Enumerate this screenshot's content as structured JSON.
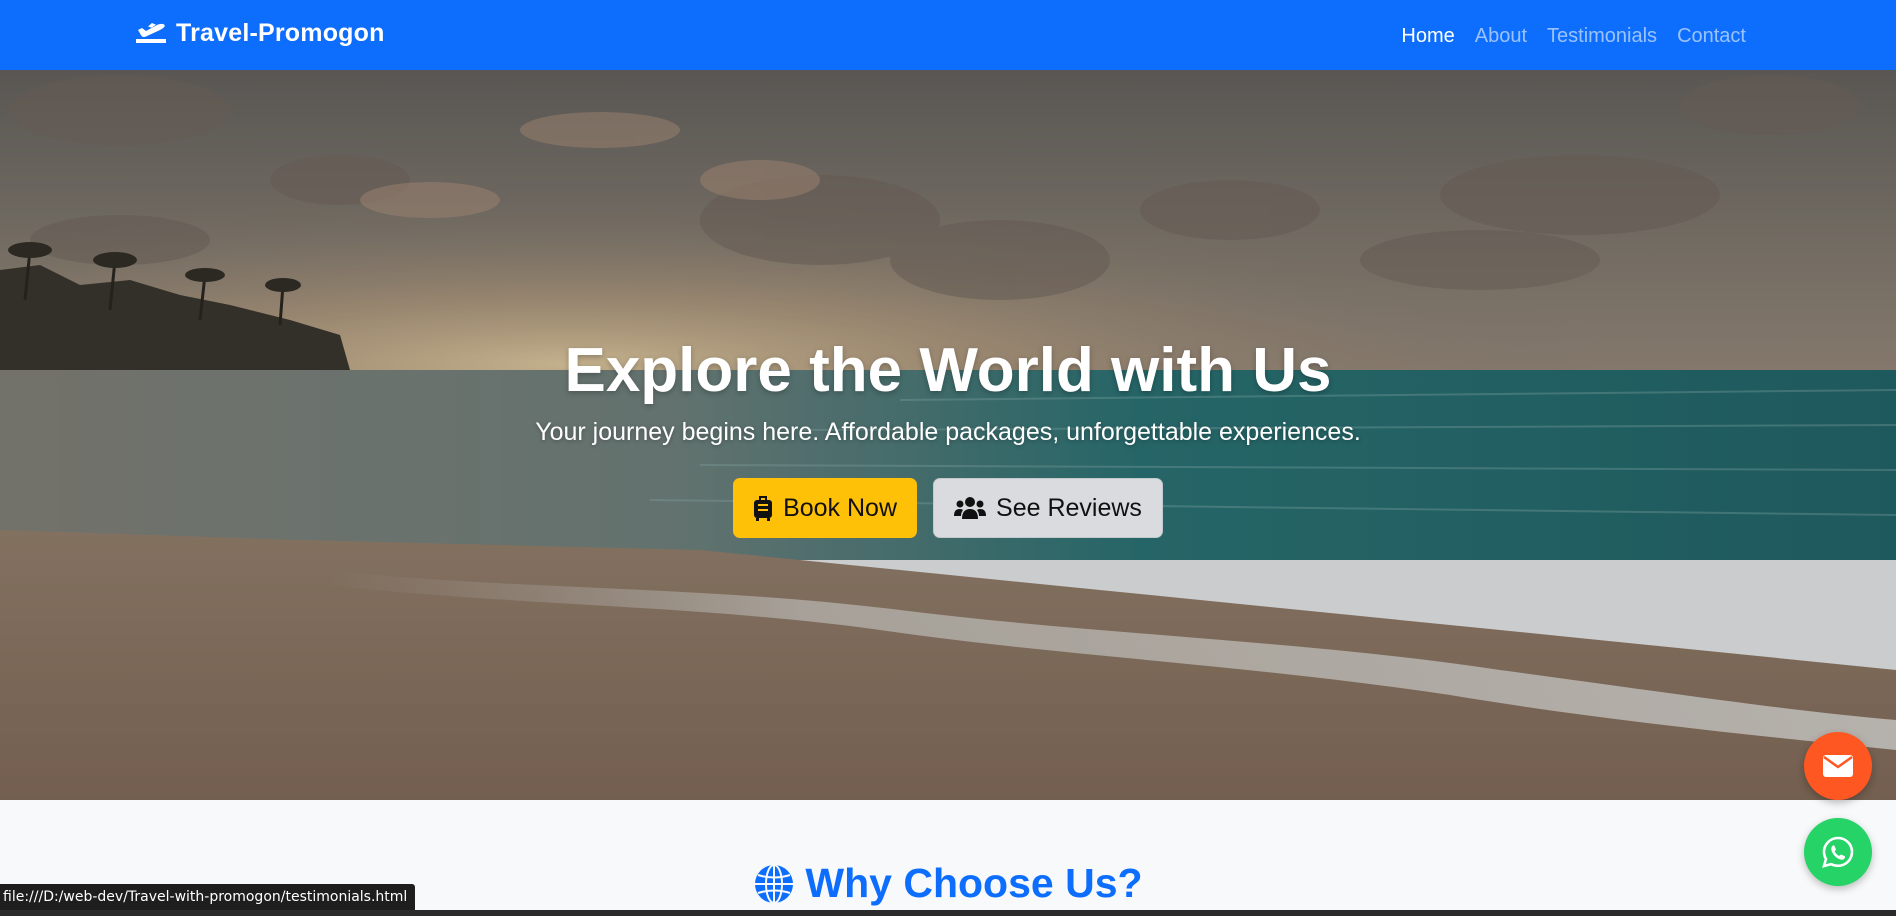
{
  "navbar": {
    "brand": "Travel-Promogon",
    "brand_icon": "plane-departure-icon",
    "links": [
      {
        "label": "Home",
        "active": true
      },
      {
        "label": "About",
        "active": false
      },
      {
        "label": "Testimonials",
        "active": false
      },
      {
        "label": "Contact",
        "active": false
      }
    ],
    "color": "#0d6efd"
  },
  "hero": {
    "background": "beach-sunset-photo",
    "title": "Explore the World with Us",
    "subtitle": "Your journey begins here. Affordable packages, unforgettable experiences.",
    "primary_button": {
      "label": "Book Now",
      "icon": "suitcase-icon",
      "color": "#ffc107"
    },
    "secondary_button": {
      "label": "See Reviews",
      "icon": "users-icon"
    }
  },
  "why_section": {
    "title": "Why Choose Us?",
    "icon": "globe-icon",
    "color": "#0d6efd"
  },
  "floating_buttons": {
    "email": {
      "icon": "envelope-icon",
      "color": "#ff5722"
    },
    "whatsapp": {
      "icon": "whatsapp-icon",
      "color": "#25d366"
    }
  },
  "status_bar": {
    "url": "file:///D:/web-dev/Travel-with-promogon/testimonials.html"
  }
}
